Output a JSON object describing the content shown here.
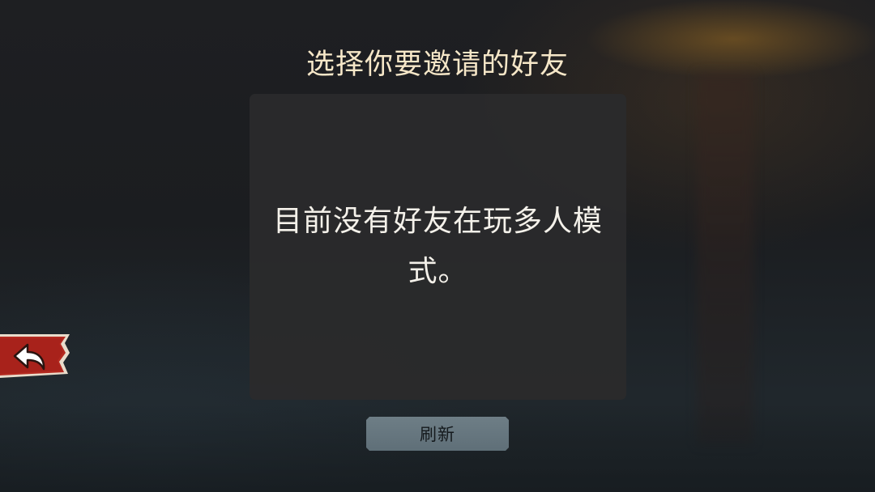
{
  "dialog": {
    "title": "选择你要邀请的好友",
    "empty_message": "目前没有好友在玩多人模式。",
    "refresh_label": "刷新"
  },
  "back_button": {
    "icon": "back-arrow-icon",
    "color": "#b8231c"
  },
  "colors": {
    "title": "#f6e7c8",
    "panel": "#2b2b2c",
    "refresh_button": "#6a7a82"
  }
}
